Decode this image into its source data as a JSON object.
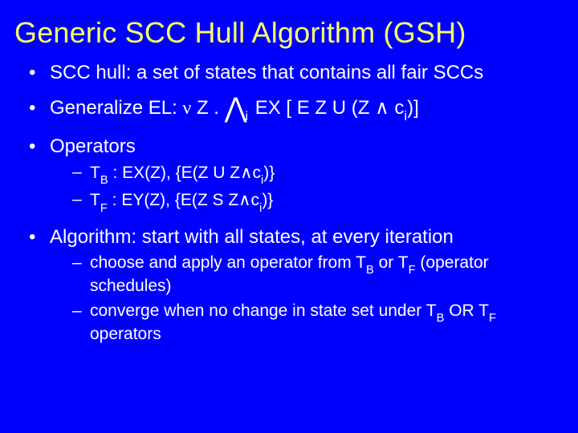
{
  "title": "Generic SCC Hull Algorithm (GSH)",
  "b1": "SCC hull: a set of states that contains all fair SCCs",
  "b2_prefix": "Generalize EL: ",
  "b2_nu": "ν",
  "b2_z": " Z . ",
  "b2_bigand": "⋀",
  "b2_i": "i",
  "b2_tail_1": " EX [ E Z U (Z ",
  "b2_and": "∧",
  "b2_tail_2": " c",
  "b2_tail_3": ")]",
  "b3": "Operators",
  "b3a_1": "T",
  "b3a_B": "B",
  "b3a_2": " : EX(Z), {E(Z U Z",
  "b3a_and": "∧",
  "b3a_3": "c",
  "b3a_i": "i",
  "b3a_4": ")}",
  "b3b_1": "T",
  "b3b_F": "F",
  "b3b_2": " : EY(Z), {E(Z S Z",
  "b3b_and": "∧",
  "b3b_3": "c",
  "b3b_i": "i",
  "b3b_4": ")}",
  "b4": "Algorithm: start with all states, at every iteration",
  "b4a_1": "choose and apply an operator from T",
  "b4a_B": "B",
  "b4a_2": " or T",
  "b4a_F": "F",
  "b4a_3": " (operator schedules)",
  "b4b_1": "converge when no change in state set under T",
  "b4b_B": "B",
  "b4b_2": " OR T",
  "b4b_F": "F",
  "b4b_3": " operators"
}
